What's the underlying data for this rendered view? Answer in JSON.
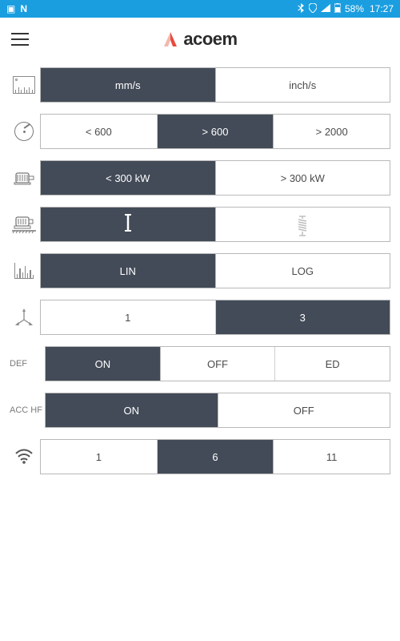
{
  "status": {
    "battery": "58%",
    "time": "17:27"
  },
  "brand": {
    "name": "acoem"
  },
  "rows": {
    "units": {
      "options": [
        "mm/s",
        "inch/s"
      ],
      "selected": 0
    },
    "speed": {
      "options": [
        "< 600",
        "> 600",
        "> 2000"
      ],
      "selected": 1
    },
    "power": {
      "options": [
        "< 300 kW",
        "> 300 kW"
      ],
      "selected": 0
    },
    "mount": {
      "options": [
        "rigid",
        "flexible"
      ],
      "selected": 0
    },
    "scale": {
      "options": [
        "LIN",
        "LOG"
      ],
      "selected": 0
    },
    "axes": {
      "options": [
        "1",
        "3"
      ],
      "selected": 1
    },
    "def": {
      "label": "DEF",
      "options": [
        "ON",
        "OFF",
        "ED"
      ],
      "selected": 0
    },
    "acchf": {
      "label": "ACC HF",
      "options": [
        "ON",
        "OFF"
      ],
      "selected": 0
    },
    "wifi": {
      "options": [
        "1",
        "6",
        "11"
      ],
      "selected": 1
    }
  }
}
